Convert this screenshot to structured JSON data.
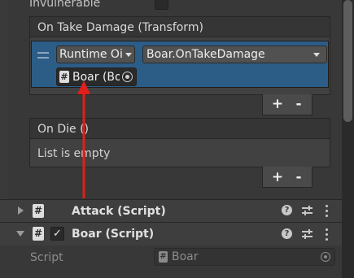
{
  "top": {
    "invulnerable_label": "Invulnerable"
  },
  "take_damage": {
    "header": "On Take Damage (Transform)",
    "row": {
      "runtime_value": "Runtime Oi",
      "function_value": "Boar.OnTakeDamage",
      "object_value": "Boar (Bo"
    },
    "plus": "+",
    "minus": "-"
  },
  "on_die": {
    "header": "On Die ()",
    "empty_text": "List is empty",
    "plus": "+",
    "minus": "-"
  },
  "components": [
    {
      "title": "Attack (Script)"
    },
    {
      "title": "Boar (Script)"
    }
  ],
  "script_field": {
    "label": "Script",
    "value": "Boar"
  },
  "colors": {
    "panel_bg": "#383838",
    "selection_blue": "#2c5d87",
    "arrow_red": "#e0201a"
  },
  "icons": [
    "hash-script-icon",
    "checkmark-icon",
    "help-icon",
    "sliders-icon",
    "kebab-menu-icon",
    "object-picker-icon",
    "foldout-triangle-icon",
    "drag-handle-icon"
  ]
}
